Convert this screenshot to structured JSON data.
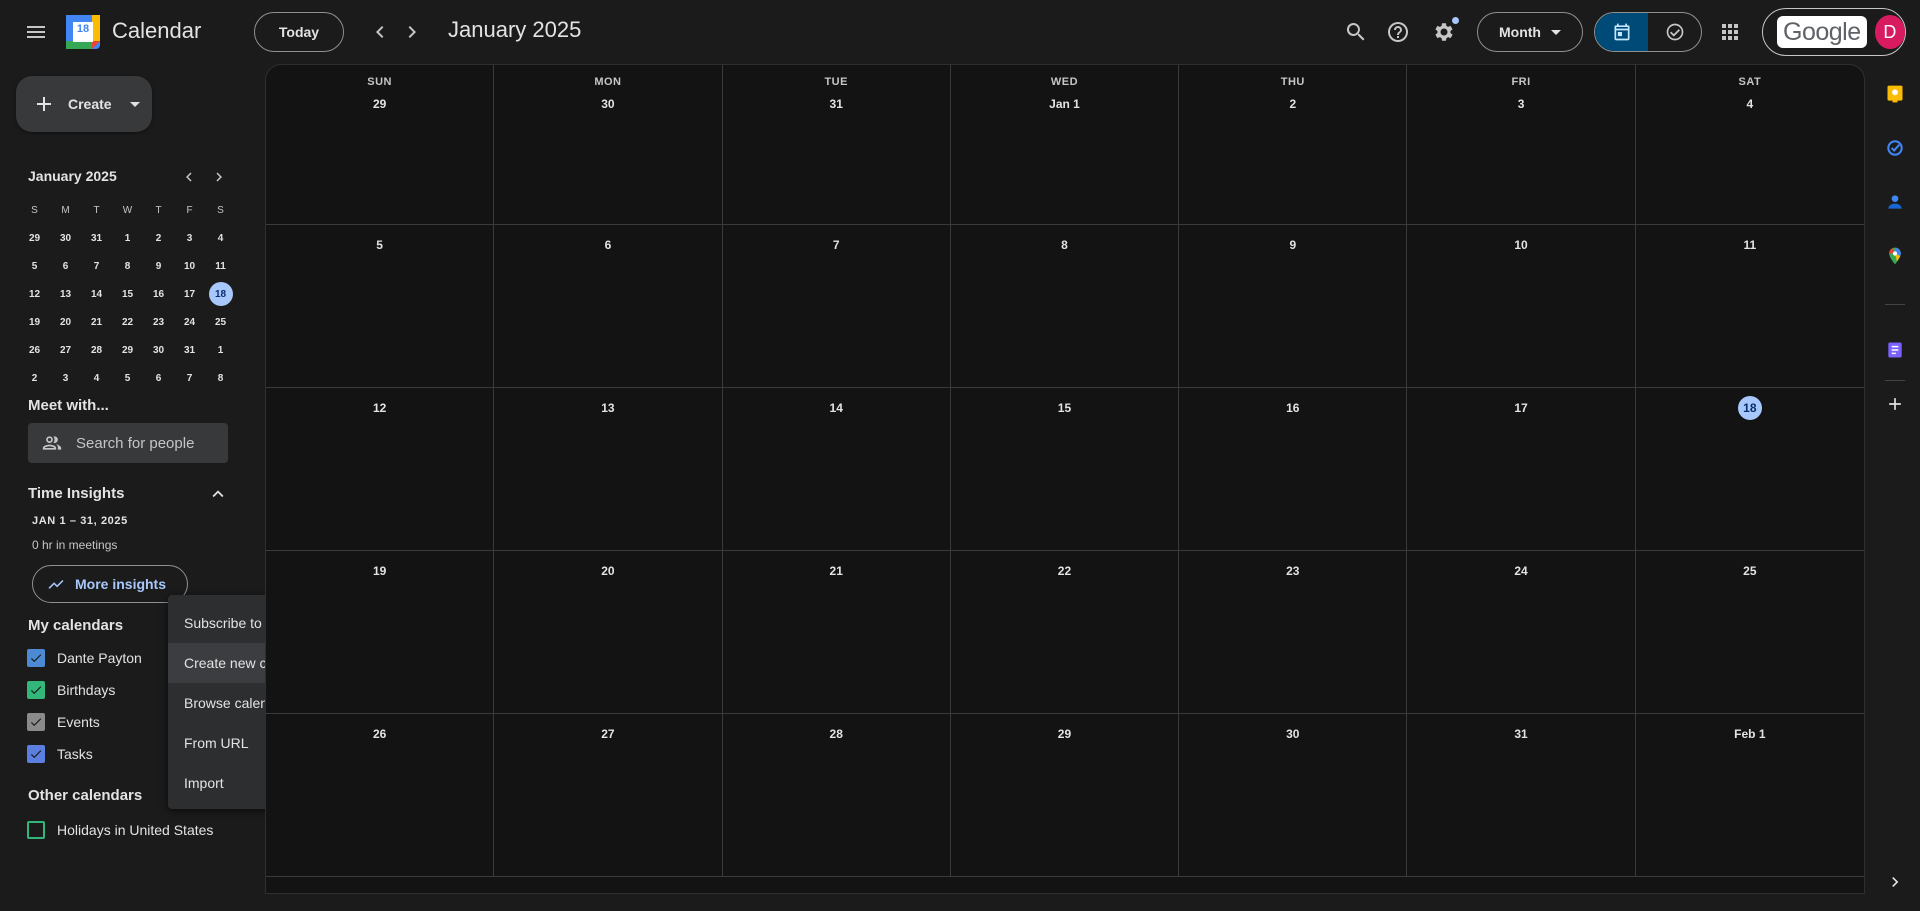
{
  "app": {
    "title": "Calendar",
    "logo_day": "18",
    "today_label": "Today",
    "current_month": "January 2025",
    "view_label": "Month",
    "account_wordmark": "Google",
    "avatar_initial": "D"
  },
  "sidebar": {
    "create_label": "Create",
    "mini_calendar": {
      "title": "January 2025",
      "weekday_heads": [
        "S",
        "M",
        "T",
        "W",
        "T",
        "F",
        "S"
      ],
      "days": [
        "29",
        "30",
        "31",
        "1",
        "2",
        "3",
        "4",
        "5",
        "6",
        "7",
        "8",
        "9",
        "10",
        "11",
        "12",
        "13",
        "14",
        "15",
        "16",
        "17",
        "18",
        "19",
        "20",
        "21",
        "22",
        "23",
        "24",
        "25",
        "26",
        "27",
        "28",
        "29",
        "30",
        "31",
        "1",
        "2",
        "3",
        "4",
        "5",
        "6",
        "7",
        "8"
      ],
      "today": "18"
    },
    "meet_with": {
      "title": "Meet with...",
      "placeholder": "Search for people"
    },
    "time_insights": {
      "title": "Time Insights",
      "range": "JAN 1 – 31, 2025",
      "hours": "0 hr in meetings",
      "more_label": "More insights"
    },
    "my_calendars_title": "My calendars",
    "my_calendars": [
      {
        "name": "Dante Payton",
        "color": "#4c8bd4",
        "checked": true
      },
      {
        "name": "Birthdays",
        "color": "#33b679",
        "checked": true
      },
      {
        "name": "Events",
        "color": "#8a8a8a",
        "checked": true
      },
      {
        "name": "Tasks",
        "color": "#5b7fdf",
        "checked": true
      }
    ],
    "other_calendars_title": "Other calendars",
    "other_calendars": [
      {
        "name": "Holidays in United States",
        "color": "#33b679",
        "checked": false
      }
    ]
  },
  "add_calendar_menu": {
    "items": [
      "Subscribe to calendar",
      "Create new calendar",
      "Browse calendars of interest",
      "From URL",
      "Import"
    ],
    "hovered_index": 1
  },
  "month_view": {
    "weekdays": [
      "SUN",
      "MON",
      "TUE",
      "WED",
      "THU",
      "FRI",
      "SAT"
    ],
    "cells": [
      "29",
      "30",
      "31",
      "Jan 1",
      "2",
      "3",
      "4",
      "5",
      "6",
      "7",
      "8",
      "9",
      "10",
      "11",
      "12",
      "13",
      "14",
      "15",
      "16",
      "17",
      "18",
      "19",
      "20",
      "21",
      "22",
      "23",
      "24",
      "25",
      "26",
      "27",
      "28",
      "29",
      "30",
      "31",
      "Feb 1"
    ],
    "today": "18"
  },
  "colors": {
    "accent": "#a8c7fa",
    "selected_toggle": "#004a77",
    "avatar": "#d81b60"
  },
  "side_panel": {
    "icons": [
      "keep-icon",
      "tasks-icon",
      "contacts-icon",
      "maps-icon",
      "notes-icon",
      "add-icon",
      "chevron-right-icon"
    ]
  }
}
